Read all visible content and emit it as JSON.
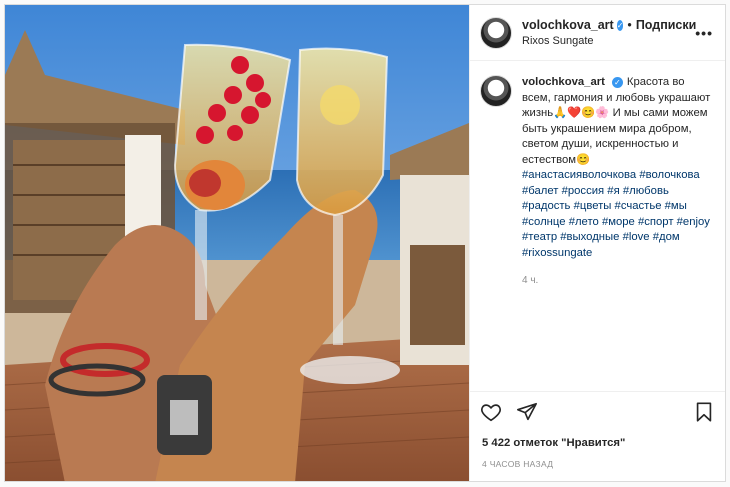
{
  "header": {
    "username": "volochkova_art",
    "follow_label": "Подписки",
    "location": "Rixos Sungate",
    "more_label": "•••"
  },
  "caption": {
    "username": "volochkova_art",
    "text": "Красота во всем, гармония и любовь украшают жизнь🙏❤️😊🌸 И мы сами можем быть украшением мира добром, светом души, искренностью и естеством😊",
    "hashtags": "#анастасияволочкова #волочкова #балет #россия #я #любовь #радость #цветы #счастье #мы #солнце #лето #море #спорт #enjoy #театр #выходные #love #дом #rixossungate",
    "time": "4 ч."
  },
  "actions": {
    "like_icon": "heart-icon",
    "share_icon": "share-icon",
    "save_icon": "bookmark-icon"
  },
  "likes_label": "5 422 отметок \"Нравится\"",
  "posted_ago": "4 ЧАСОВ НАЗАД"
}
